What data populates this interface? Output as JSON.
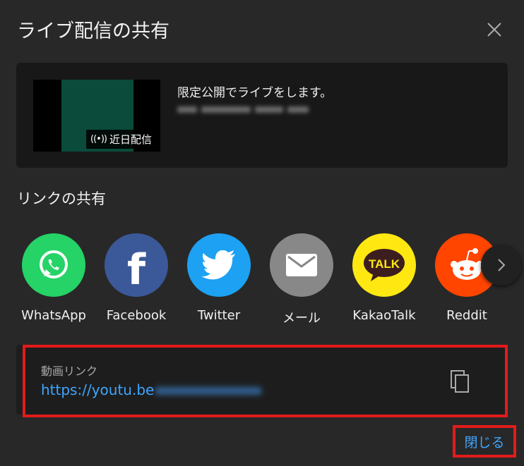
{
  "dialog": {
    "title": "ライブ配信の共有",
    "close_icon": "close-icon"
  },
  "video": {
    "title": "限定公開でライブをします。",
    "badge_icon": "live-broadcast-icon",
    "badge_text": "近日配信",
    "thumbnail_color": "#0b4b3b"
  },
  "share": {
    "heading": "リンクの共有",
    "targets": [
      {
        "label": "WhatsApp",
        "icon": "whatsapp-icon",
        "color": "#25d366"
      },
      {
        "label": "Facebook",
        "icon": "facebook-icon",
        "color": "#3b5998"
      },
      {
        "label": "Twitter",
        "icon": "twitter-icon",
        "color": "#1da1f2"
      },
      {
        "label": "メール",
        "icon": "mail-icon",
        "color": "#888888"
      },
      {
        "label": "KakaoTalk",
        "icon": "kakaotalk-icon",
        "color": "#ffe812"
      },
      {
        "label": "Reddit",
        "icon": "reddit-icon",
        "color": "#ff4500"
      }
    ],
    "next_icon": "chevron-right-icon"
  },
  "link": {
    "label": "動画リンク",
    "url_visible": "https://youtu.be",
    "copy_icon": "copy-icon"
  },
  "footer": {
    "close_label": "閉じる"
  },
  "colors": {
    "background": "#282828",
    "accent": "#3ea6ff",
    "highlight": "#e21b1b"
  }
}
